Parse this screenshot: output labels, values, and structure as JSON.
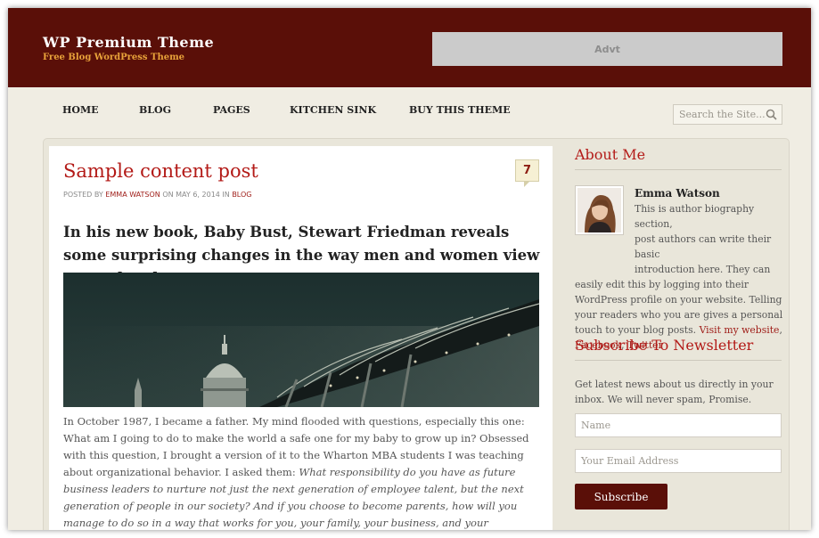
{
  "header": {
    "site_title": "WP Premium Theme",
    "tagline": "Free Blog WordPress Theme",
    "ad_label": "Advt",
    "bg_color": "#5a0f08",
    "tagline_color": "#e8a23a"
  },
  "nav": {
    "items": [
      {
        "label": "HOME"
      },
      {
        "label": "BLOG"
      },
      {
        "label": "PAGES"
      },
      {
        "label": "KITCHEN SINK"
      },
      {
        "label": "BUY THIS THEME"
      }
    ],
    "search_placeholder": "Search the Site..."
  },
  "post": {
    "title": "Sample content post",
    "comment_count": "7",
    "meta": {
      "posted_by": "POSTED BY",
      "author": "EMMA WATSON",
      "on": "ON MAY 6, 2014 IN",
      "category": "BLOG"
    },
    "lead": "In his new book, Baby Bust, Stewart Friedman reveals some surprising changes in the way men and women view parenthood.",
    "body_plain": "In October 1987, I became a father. My mind flooded with questions, especially this one:  What am I going to do to make the world a safe one for my baby to grow up in? Obsessed with this question, I brought a version of it to the Wharton MBA students I was teaching about organizational behavior. I asked them: ",
    "body_italic": "What responsibility do you have as future business leaders to nurture not just the next generation of employee talent, but the next generation of people in our society? And if you choose to become parents, how will you manage to do so in a way that works for you, your family, your business, and your community?",
    "title_color": "#b31a17"
  },
  "sidebar": {
    "about": {
      "title": "About Me",
      "name": "Emma Watson",
      "bio_part1": "This is author biography section,",
      "bio_part2": "post authors can write their basic",
      "bio_part3": "introduction here. They can",
      "bio_rest": "easily edit this by logging into their WordPress profile on your website. Telling your readers who you are gives a personal touch to your blog posts.",
      "link_website": "Visit my website",
      "link_facebook": "Facebook",
      "link_twitter": "Twitter"
    },
    "newsletter": {
      "title": "Subscribe To Newsletter",
      "description": "Get latest news about us directly in your inbox. We will never spam, Promise.",
      "name_placeholder": "Name",
      "email_placeholder": "Your Email Address",
      "button_label": "Subscribe"
    }
  }
}
